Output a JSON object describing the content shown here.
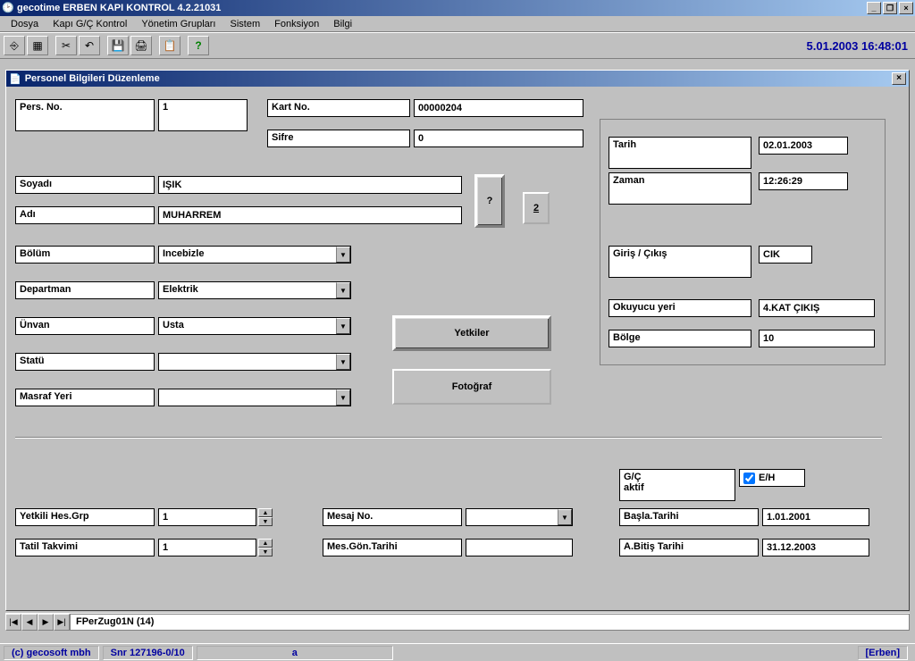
{
  "app": {
    "title": "gecotime  ERBEN KAPI  KONTROL  4.2.21031"
  },
  "menus": {
    "dosya": "Dosya",
    "kapi": "Kapı G/Ç Kontrol",
    "yonetim": "Yönetim Grupları",
    "sistem": "Sistem",
    "fonksiyon": "Fonksiyon",
    "bilgi": "Bilgi"
  },
  "clock": "5.01.2003  16:48:01",
  "subwindow": {
    "title": "Personel Bilgileri Düzenleme"
  },
  "labels": {
    "pers_no": "Pers. No.",
    "kart_no": "Kart No.",
    "sifre": "Sifre",
    "soyadi": "Soyadı",
    "adi": "Adı",
    "bolum": "Bölüm",
    "departman": "Departman",
    "unvan": "Ünvan",
    "statu": "Statü",
    "masraf": "Masraf Yeri",
    "tarih": "Tarih",
    "zaman": "Zaman",
    "giris_cikis": "Giriş / Çıkış",
    "okuyucu": "Okuyucu yeri",
    "bolge": "Bölge",
    "gc_aktif": "G/Ç\naktif",
    "eh": "E/H",
    "basla": "Başla.Tarihi",
    "bitis": "A.Bitiş Tarihi",
    "yetkili": "Yetkili Hes.Grp",
    "tatil": "Tatil Takvimi",
    "mesaj_no": "Mesaj No.",
    "mes_gon": "Mes.Gön.Tarihi"
  },
  "values": {
    "pers_no": "1",
    "kart_no": "00000204",
    "sifre": "0",
    "soyadi": "IŞIK",
    "adi": "MUHARREM",
    "bolum": "Incebizle",
    "departman": "Elektrik",
    "unvan": "Usta",
    "statu": "",
    "masraf": "",
    "tarih": "02.01.2003",
    "zaman": "12:26:29",
    "giris_cikis": "CIK",
    "okuyucu": "4.KAT ÇIKIŞ",
    "bolge": "10",
    "basla": "1.01.2001",
    "bitis": "31.12.2003",
    "yetkili": "1",
    "tatil": "1",
    "mesaj_no": "",
    "mes_gon": ""
  },
  "buttons": {
    "help_small": "?",
    "two": "2",
    "yetkiler": "Yetkiler",
    "fotograf": "Fotoğraf"
  },
  "nav": {
    "text": "FPerZug01N (14)"
  },
  "status": {
    "copyright": "(c) gecosoft mbh",
    "snr": "Snr 127196-0/10",
    "mid": "a",
    "right": "[Erben]"
  }
}
